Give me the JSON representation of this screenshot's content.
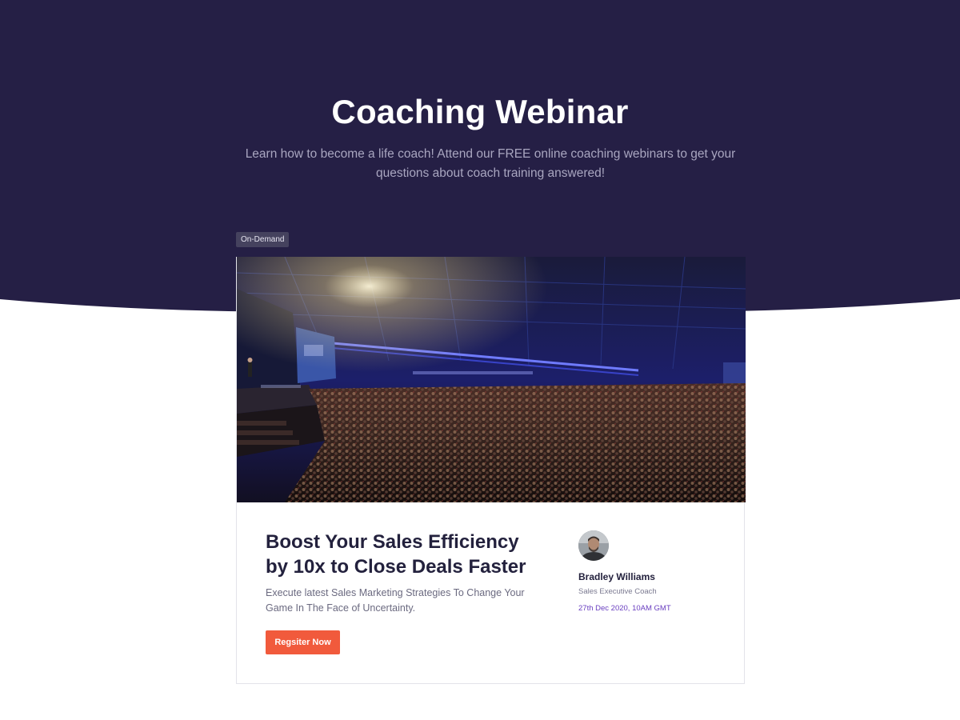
{
  "hero": {
    "title": "Coaching Webinar",
    "subtitle": "Learn how to become a life coach! Attend our FREE online coaching webinars to get your questions about coach training answered!"
  },
  "webinar": {
    "badge": "On-Demand",
    "title": "Boost Your Sales Efficiency by 10x to Close Deals Faster",
    "description": "Execute latest Sales Marketing Strategies To Change Your Game In The Face of Uncertainty.",
    "register_label": "Regsiter Now",
    "speaker": {
      "name": "Bradley Williams",
      "role": "Sales Executive Coach"
    },
    "date": "27th Dec 2020, 10AM GMT"
  },
  "colors": {
    "hero_bg": "#251f45",
    "accent_button": "#f15a3c",
    "date_text": "#6a3fc0",
    "title_text": "#23213d"
  }
}
